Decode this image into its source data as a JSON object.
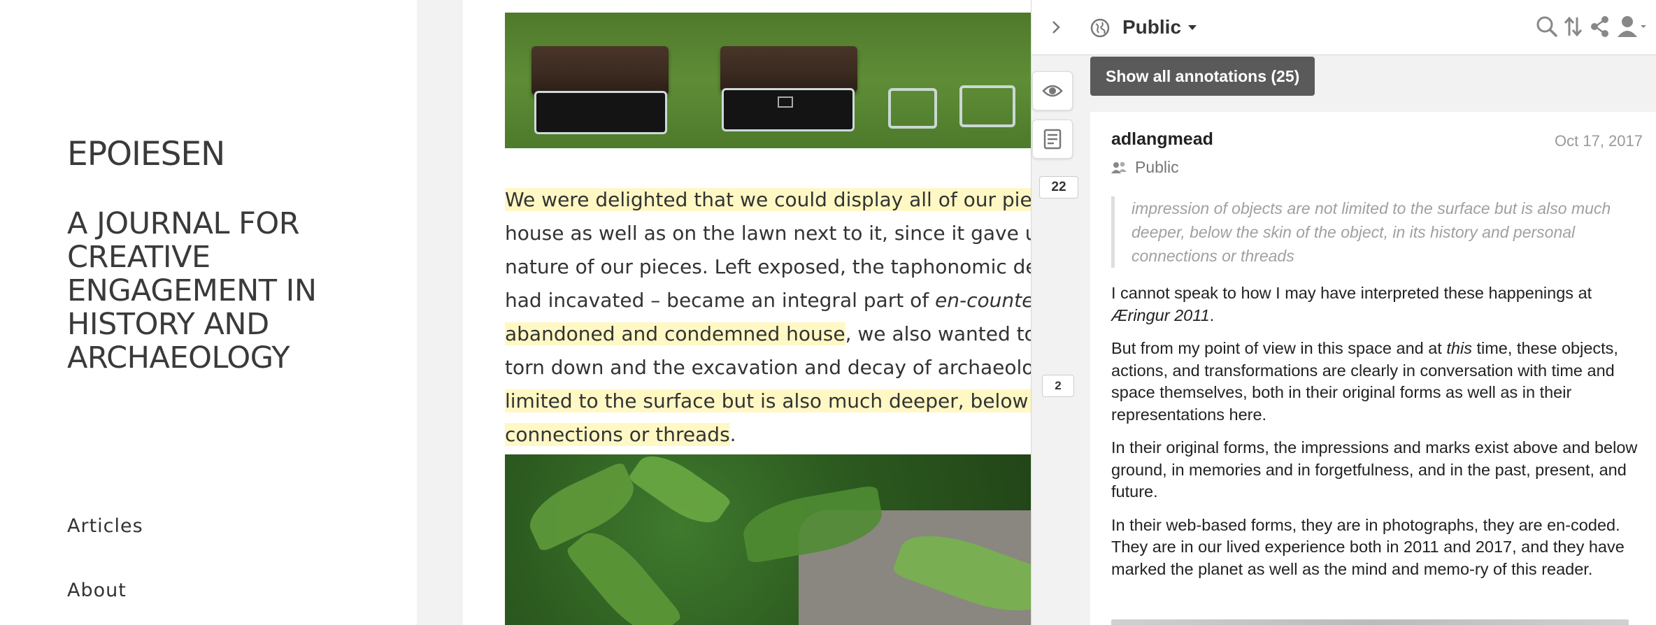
{
  "site": {
    "title": "EPOIESEN",
    "tagline": "A JOURNAL FOR CREATIVE ENGAGEMENT IN HISTORY AND ARCHAEOLOGY",
    "nav": [
      "Articles",
      "About"
    ]
  },
  "article": {
    "lines": [
      {
        "segments": [
          {
            "text": "We were delighted that we could display all of our pieces d",
            "hl": true
          }
        ]
      },
      {
        "segments": [
          {
            "text": "house as well as on the lawn next to it, since it gave us the c",
            "hl": false
          }
        ]
      },
      {
        "segments": [
          {
            "text": "nature of our pieces. Left exposed, the taphonomic degrada",
            "hl": false
          }
        ]
      },
      {
        "segments": [
          {
            "text": "had incavated – became an integral part of ",
            "hl": false
          },
          {
            "text": "en-counter-map",
            "hl": false,
            "italic": true
          }
        ]
      },
      {
        "segments": [
          {
            "text": "abandoned and condemned house",
            "hl": true
          },
          {
            "text": ", we also wanted to poir",
            "hl": false
          }
        ]
      },
      {
        "segments": [
          {
            "text": "torn down and the excavation and decay of archaeology/ar",
            "hl": false
          }
        ]
      },
      {
        "segments": [
          {
            "text": "limited to the surface but is also much deeper, below the sk",
            "hl": true
          }
        ]
      },
      {
        "segments": [
          {
            "text": "connections or threads",
            "hl": true
          },
          {
            "text": ".",
            "hl": false
          }
        ]
      }
    ]
  },
  "sidebar_controls": {
    "bucket_counts": [
      "22",
      "2"
    ],
    "icons": [
      "eye-icon",
      "note-icon"
    ]
  },
  "annotation_pane": {
    "group_label": "Public",
    "show_all_label": "Show all annotations (25)",
    "topbar_icons": [
      "search-icon",
      "sort-icon",
      "share-icon",
      "user-icon"
    ],
    "annotation": {
      "user": "adlangmead",
      "date": "Oct 17, 2017",
      "privacy": "Public",
      "quote": "impression of objects are not limited to the surface but is also much deeper, below the skin of the object, in its history and personal connections or threads",
      "body": [
        {
          "parts": [
            {
              "t": "I cannot speak to how I may have interpreted these happenings at "
            },
            {
              "t": "Æringur 2011",
              "i": true
            },
            {
              "t": "."
            }
          ]
        },
        {
          "parts": [
            {
              "t": "But from my point of view in this space and at "
            },
            {
              "t": "this",
              "i": true
            },
            {
              "t": " time, these objects, actions, and transformations are clearly in conversation with time and space themselves, both in their original forms as well as in their representations here."
            }
          ]
        },
        {
          "parts": [
            {
              "t": "In their original forms, the impressions and marks exist above and below ground, in memories and in forgetfulness, and in the past, present, and future."
            }
          ]
        },
        {
          "parts": [
            {
              "t": "In their web-based forms, they are in photographs, they are en-coded. They are in our lived experience both in 2011 and 2017, and they have marked the planet as well as the mind and memo-ry of this reader."
            }
          ]
        }
      ]
    }
  },
  "colors": {
    "highlight": "#fff8c4",
    "button_dark": "#5a5a5a",
    "pane_bg": "#f2f2f2"
  }
}
